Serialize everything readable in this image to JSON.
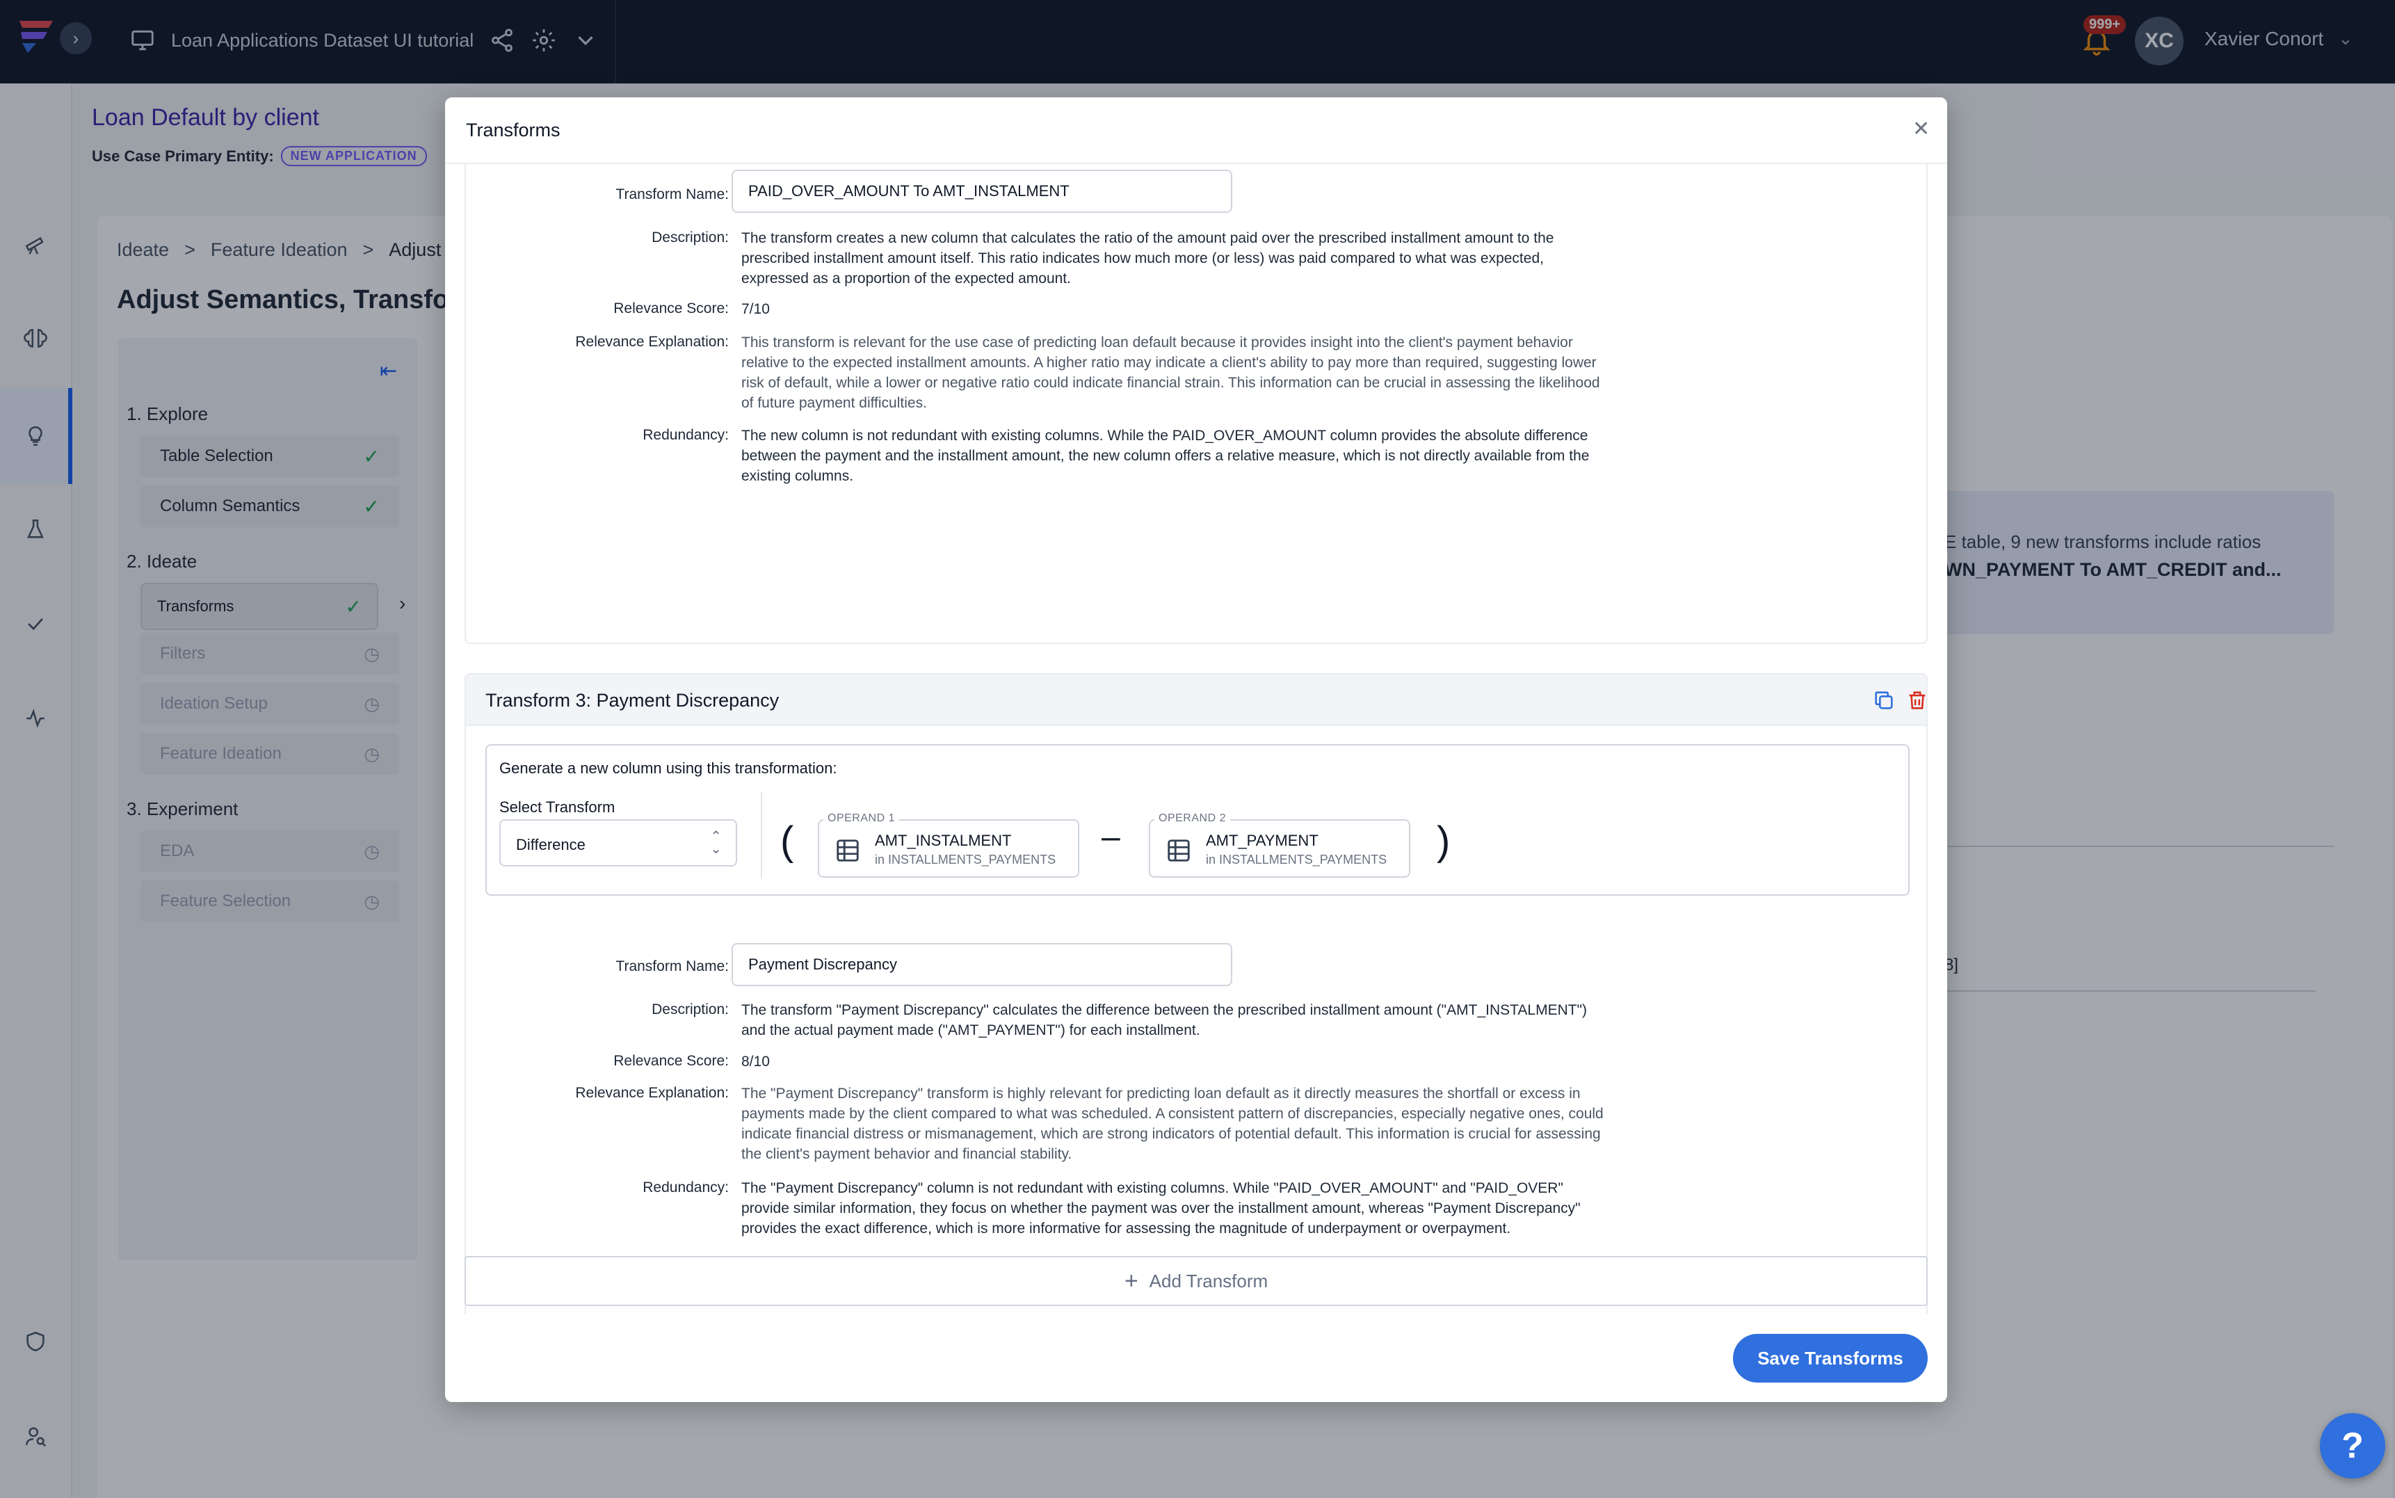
{
  "topbar": {
    "project_title": "Loan Applications Dataset UI tutorial",
    "notification_count": "999+",
    "user_initials": "XC",
    "user_name": "Xavier Conort"
  },
  "background": {
    "page_title": "Loan Default by client",
    "entity_label": "Use Case Primary Entity:",
    "entity_chip": "NEW APPLICATION",
    "breadcrumbs": [
      "Ideate",
      ">",
      "Feature Ideation",
      ">",
      "Adjust S"
    ],
    "heading": "Adjust Semantics, Transfor",
    "steps": {
      "group1": "1. Explore",
      "group2": "2. Ideate",
      "group3": "3. Experiment",
      "items": [
        "Table Selection",
        "Column Semantics",
        "Transforms",
        "Filters",
        "Ideation Setup",
        "Feature Ideation",
        "EDA",
        "Feature Selection"
      ]
    },
    "info_line1": "E table, 9 new transforms include ratios",
    "info_line2": "WN_PAYMENT To AMT_CREDIT and...",
    "cell_fragment": "8]"
  },
  "modal": {
    "title": "Transforms",
    "labels": {
      "transform_name": "Transform Name:",
      "description": "Description:",
      "relevance_score": "Relevance Score:",
      "relevance_explanation": "Relevance Explanation:",
      "redundancy": "Redundancy:"
    },
    "transform2": {
      "name": "PAID_OVER_AMOUNT To AMT_INSTALMENT",
      "description": "The transform creates a new column that calculates the ratio of the amount paid over the prescribed installment amount to the prescribed installment amount itself. This ratio indicates how much more (or less) was paid compared to what was expected, expressed as a proportion of the expected amount.",
      "relevance_score": "7/10",
      "relevance_explanation": "This transform is relevant for the use case of predicting loan default because it provides insight into the client's payment behavior relative to the expected installment amounts. A higher ratio may indicate a client's ability to pay more than required, suggesting lower risk of default, while a lower or negative ratio could indicate financial strain. This information can be crucial in assessing the likelihood of future payment difficulties.",
      "redundancy": "The new column is not redundant with existing columns. While the PAID_OVER_AMOUNT column provides the absolute difference between the payment and the installment amount, the new column offers a relative measure, which is not directly available from the existing columns."
    },
    "transform3": {
      "header": "Transform 3: Payment Discrepancy",
      "generate_label": "Generate a new column using this transformation:",
      "select_label": "Select Transform",
      "select_value": "Difference",
      "open_paren": "(",
      "close_paren": ")",
      "operator": "–",
      "operand1": {
        "caption": "OPERAND 1",
        "name": "AMT_INSTALMENT",
        "in": "in",
        "table": "INSTALLMENTS_PAYMENTS"
      },
      "operand2": {
        "caption": "OPERAND 2",
        "name": "AMT_PAYMENT",
        "in": "in",
        "table": "INSTALLMENTS_PAYMENTS"
      },
      "name": "Payment Discrepancy",
      "description": "The transform \"Payment Discrepancy\" calculates the difference between the prescribed installment amount (\"AMT_INSTALMENT\") and the actual payment made (\"AMT_PAYMENT\") for each installment.",
      "relevance_score": "8/10",
      "relevance_explanation": "The \"Payment Discrepancy\" transform is highly relevant for predicting loan default as it directly measures the shortfall or excess in payments made by the client compared to what was scheduled. A consistent pattern of discrepancies, especially negative ones, could indicate financial distress or mismanagement, which are strong indicators of potential default. This information is crucial for assessing the client's payment behavior and financial stability.",
      "redundancy": "The \"Payment Discrepancy\" column is not redundant with existing columns. While \"PAID_OVER_AMOUNT\" and \"PAID_OVER\" provide similar information, they focus on whether the payment was over the installment amount, whereas \"Payment Discrepancy\" provides the exact difference, which is more informative for assessing the magnitude of underpayment or overpayment."
    },
    "add_transform": "Add Transform",
    "save": "Save Transforms"
  },
  "help_label": "?"
}
